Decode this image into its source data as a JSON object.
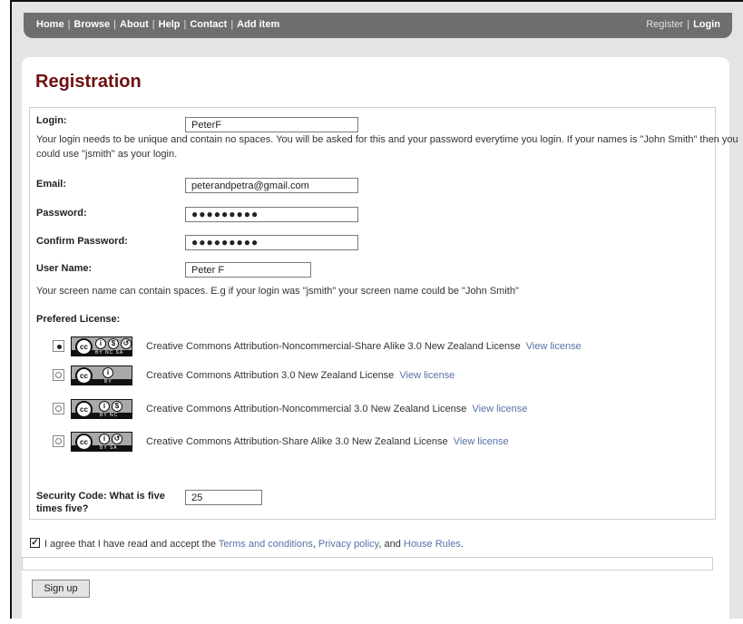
{
  "nav": {
    "left": [
      "Home",
      "Browse",
      "About",
      "Help",
      "Contact",
      "Add item"
    ],
    "register": "Register",
    "login": "Login"
  },
  "page_title": "Registration",
  "form": {
    "login": {
      "label": "Login:",
      "value": "PeterF",
      "help_line1": "Your login needs to be unique and contain no spaces. You will be asked for this and your password everytime you login. If your names is \"John Smith\" then you",
      "help_line2": "could use \"jsmith\" as your login."
    },
    "email": {
      "label": "Email:",
      "value": "peterandpetra@gmail.com"
    },
    "password": {
      "label": "Password:",
      "mask": "●●●●●●●●●"
    },
    "confirm_password": {
      "label": "Confirm Password:",
      "mask": "●●●●●●●●●"
    },
    "username": {
      "label": "User Name:",
      "value": "Peter F",
      "help": "Your screen name can contain spaces. E.g if your login was \"jsmith\" your screen name could be \"John Smith\""
    },
    "license": {
      "label": "Prefered License:",
      "options": [
        {
          "text": "Creative Commons Attribution-Noncommercial-Share Alike 3.0 New Zealand License",
          "link": "View license",
          "selected": true,
          "codes": "BY  NC  SA"
        },
        {
          "text": "Creative Commons Attribution 3.0 New Zealand License",
          "link": "View license",
          "selected": false,
          "codes": "BY"
        },
        {
          "text": "Creative Commons Attribution-Noncommercial 3.0 New Zealand License",
          "link": "View license",
          "selected": false,
          "codes": "BY  NC"
        },
        {
          "text": "Creative Commons Attribution-Share Alike 3.0 New Zealand License",
          "link": "View license",
          "selected": false,
          "codes": "BY  SA"
        }
      ]
    },
    "security": {
      "label_line1": "Security Code: What is five",
      "label_line2": "times five?",
      "value": "25"
    }
  },
  "agree": {
    "checked": true,
    "prefix": "I agree that I have read and accept the",
    "terms": "Terms and conditions",
    "comma": ",",
    "privacy": "Privacy policy",
    "and": ", and",
    "house": "House Rules",
    "period": "."
  },
  "signup_label": "Sign up",
  "colors": {
    "nav_bg": "#6e6e6e",
    "title": "#6e1010",
    "link": "#5572a8",
    "frame_bg": "#e4e4e4"
  }
}
